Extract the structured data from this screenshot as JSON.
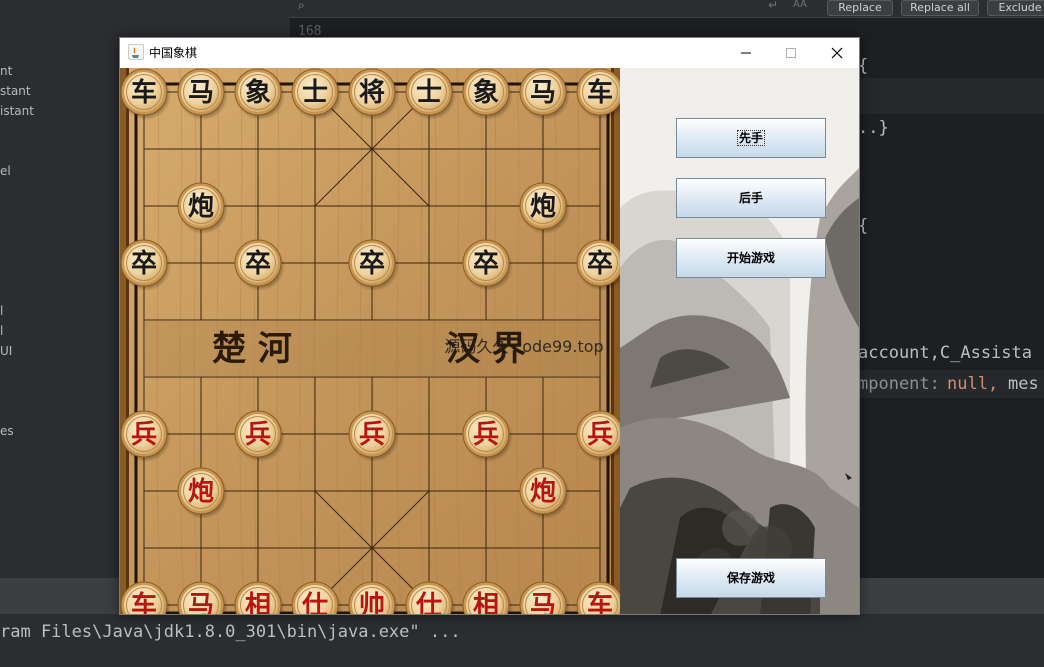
{
  "ide": {
    "left_items": [
      "nt",
      "stant",
      "istant",
      "el",
      "l",
      "l",
      "UI",
      "es"
    ],
    "find_bar": {
      "replace_label": "Replace",
      "replace_all_label": "Replace all",
      "exclude_label": "Exclude"
    },
    "gutter_line": "168",
    "code_lines": [
      "{",
      "..}",
      "{",
      "account,C_Assista",
      "mponent:",
      "null,",
      "mes"
    ],
    "console_text": "ram Files\\Java\\jdk1.8.0_301\\bin\\java.exe\" ..."
  },
  "window": {
    "title": "中国象棋"
  },
  "board": {
    "river_left": "楚 河",
    "river_right": "汉 界",
    "watermark": "源码久久 code99.top",
    "black_pieces": [
      {
        "label": "车",
        "col": 0,
        "row": 0
      },
      {
        "label": "马",
        "col": 1,
        "row": 0
      },
      {
        "label": "象",
        "col": 2,
        "row": 0
      },
      {
        "label": "士",
        "col": 3,
        "row": 0
      },
      {
        "label": "将",
        "col": 4,
        "row": 0
      },
      {
        "label": "士",
        "col": 5,
        "row": 0
      },
      {
        "label": "象",
        "col": 6,
        "row": 0
      },
      {
        "label": "马",
        "col": 7,
        "row": 0
      },
      {
        "label": "车",
        "col": 8,
        "row": 0
      },
      {
        "label": "炮",
        "col": 1,
        "row": 2
      },
      {
        "label": "炮",
        "col": 7,
        "row": 2
      },
      {
        "label": "卒",
        "col": 0,
        "row": 3
      },
      {
        "label": "卒",
        "col": 2,
        "row": 3
      },
      {
        "label": "卒",
        "col": 4,
        "row": 3
      },
      {
        "label": "卒",
        "col": 6,
        "row": 3
      },
      {
        "label": "卒",
        "col": 8,
        "row": 3
      }
    ],
    "red_pieces": [
      {
        "label": "兵",
        "col": 0,
        "row": 6
      },
      {
        "label": "兵",
        "col": 2,
        "row": 6
      },
      {
        "label": "兵",
        "col": 4,
        "row": 6
      },
      {
        "label": "兵",
        "col": 6,
        "row": 6
      },
      {
        "label": "兵",
        "col": 8,
        "row": 6
      },
      {
        "label": "炮",
        "col": 1,
        "row": 7
      },
      {
        "label": "炮",
        "col": 7,
        "row": 7
      },
      {
        "label": "车",
        "col": 0,
        "row": 9
      },
      {
        "label": "马",
        "col": 1,
        "row": 9
      },
      {
        "label": "相",
        "col": 2,
        "row": 9
      },
      {
        "label": "仕",
        "col": 3,
        "row": 9
      },
      {
        "label": "帅",
        "col": 4,
        "row": 9
      },
      {
        "label": "仕",
        "col": 5,
        "row": 9
      },
      {
        "label": "相",
        "col": 6,
        "row": 9
      },
      {
        "label": "马",
        "col": 7,
        "row": 9
      },
      {
        "label": "车",
        "col": 8,
        "row": 9
      }
    ]
  },
  "panel": {
    "first_move_label": "先手",
    "second_move_label": "后手",
    "start_game_label": "开始游戏",
    "save_game_label": "保存游戏"
  },
  "colors": {
    "black_piece_text": "#1a1a1a",
    "red_piece_text": "#b8150f",
    "board_wood": "#c79a5e"
  }
}
